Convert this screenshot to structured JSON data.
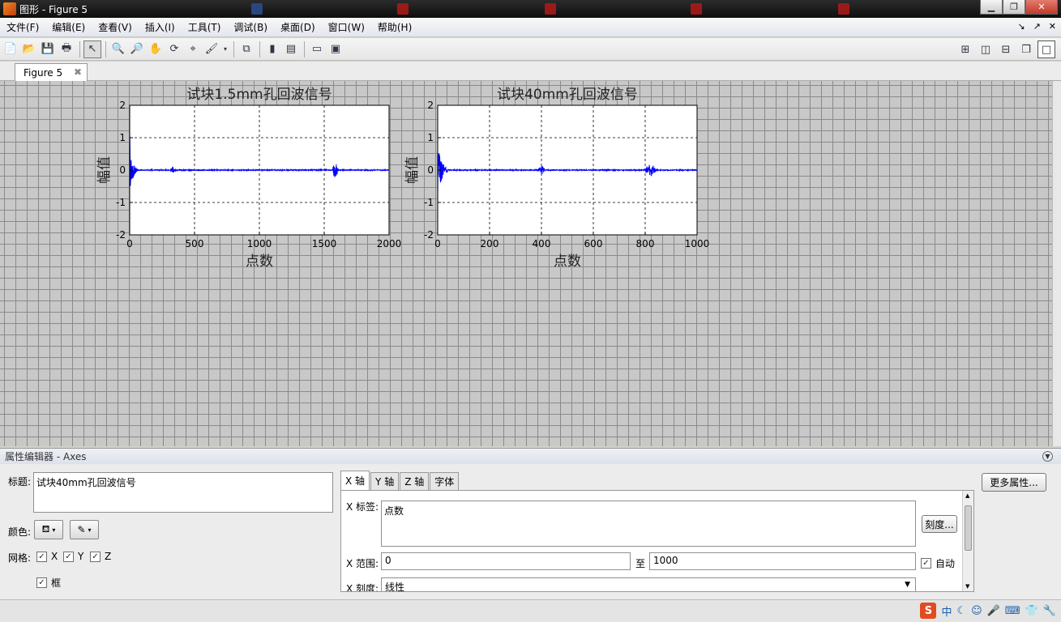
{
  "window": {
    "title": "图形 - Figure 5"
  },
  "menu": [
    "文件(F)",
    "编辑(E)",
    "查看(V)",
    "插入(I)",
    "工具(T)",
    "调试(B)",
    "桌面(D)",
    "窗口(W)",
    "帮助(H)"
  ],
  "doc_tab": {
    "label": "Figure 5"
  },
  "chart_data": [
    {
      "type": "line",
      "title": "试块1.5mm孔回波信号",
      "xlabel": "点数",
      "ylabel": "幅值",
      "xlim": [
        0,
        2000
      ],
      "ylim": [
        -2,
        2
      ],
      "xticks": [
        "0",
        "500",
        "1000",
        "1500",
        "2000"
      ],
      "yticks": [
        "-2",
        "-1",
        "0",
        "1",
        "2"
      ],
      "grid": true,
      "series_color": "#0000ff",
      "features": [
        {
          "type": "decay",
          "x_start": 0,
          "x_end": 60,
          "amplitude": 1.1
        },
        {
          "type": "burst",
          "center": 330,
          "width": 30,
          "amplitude": 0.12
        },
        {
          "type": "burst",
          "center": 1585,
          "width": 40,
          "amplitude": 0.3
        }
      ]
    },
    {
      "type": "line",
      "title": "试块40mm孔回波信号",
      "xlabel": "点数",
      "ylabel": "幅值",
      "xlim": [
        0,
        1000
      ],
      "ylim": [
        -2,
        2
      ],
      "xticks": [
        "0",
        "200",
        "400",
        "600",
        "800",
        "1000"
      ],
      "yticks": [
        "-2",
        "-1",
        "0",
        "1",
        "2"
      ],
      "grid": true,
      "series_color": "#0000ff",
      "features": [
        {
          "type": "decay",
          "x_start": 0,
          "x_end": 40,
          "amplitude": 1.0
        },
        {
          "type": "burst",
          "center": 400,
          "width": 25,
          "amplitude": 0.15
        },
        {
          "type": "burst",
          "center": 820,
          "width": 45,
          "amplitude": 0.2
        }
      ]
    }
  ],
  "property_editor": {
    "header": "属性编辑器 - Axes",
    "title_label": "标题:",
    "title_value": "试块40mm孔回波信号",
    "color_label": "颜色:",
    "grid_label": "网格:",
    "grid_x": "X",
    "grid_y": "Y",
    "grid_z": "Z",
    "box_label": "框",
    "tabs": [
      "X 轴",
      "Y 轴",
      "Z 轴",
      "字体"
    ],
    "x_label_label": "X 标签:",
    "x_label_value": "点数",
    "ticks_button": "刻度...",
    "x_range_label": "X 范围:",
    "x_range_min": "0",
    "x_range_to": "至",
    "x_range_max": "1000",
    "auto_label": "自动",
    "x_scale_label": "X 刻度:",
    "x_scale_value": "线性",
    "more_props_button": "更多属性..."
  }
}
